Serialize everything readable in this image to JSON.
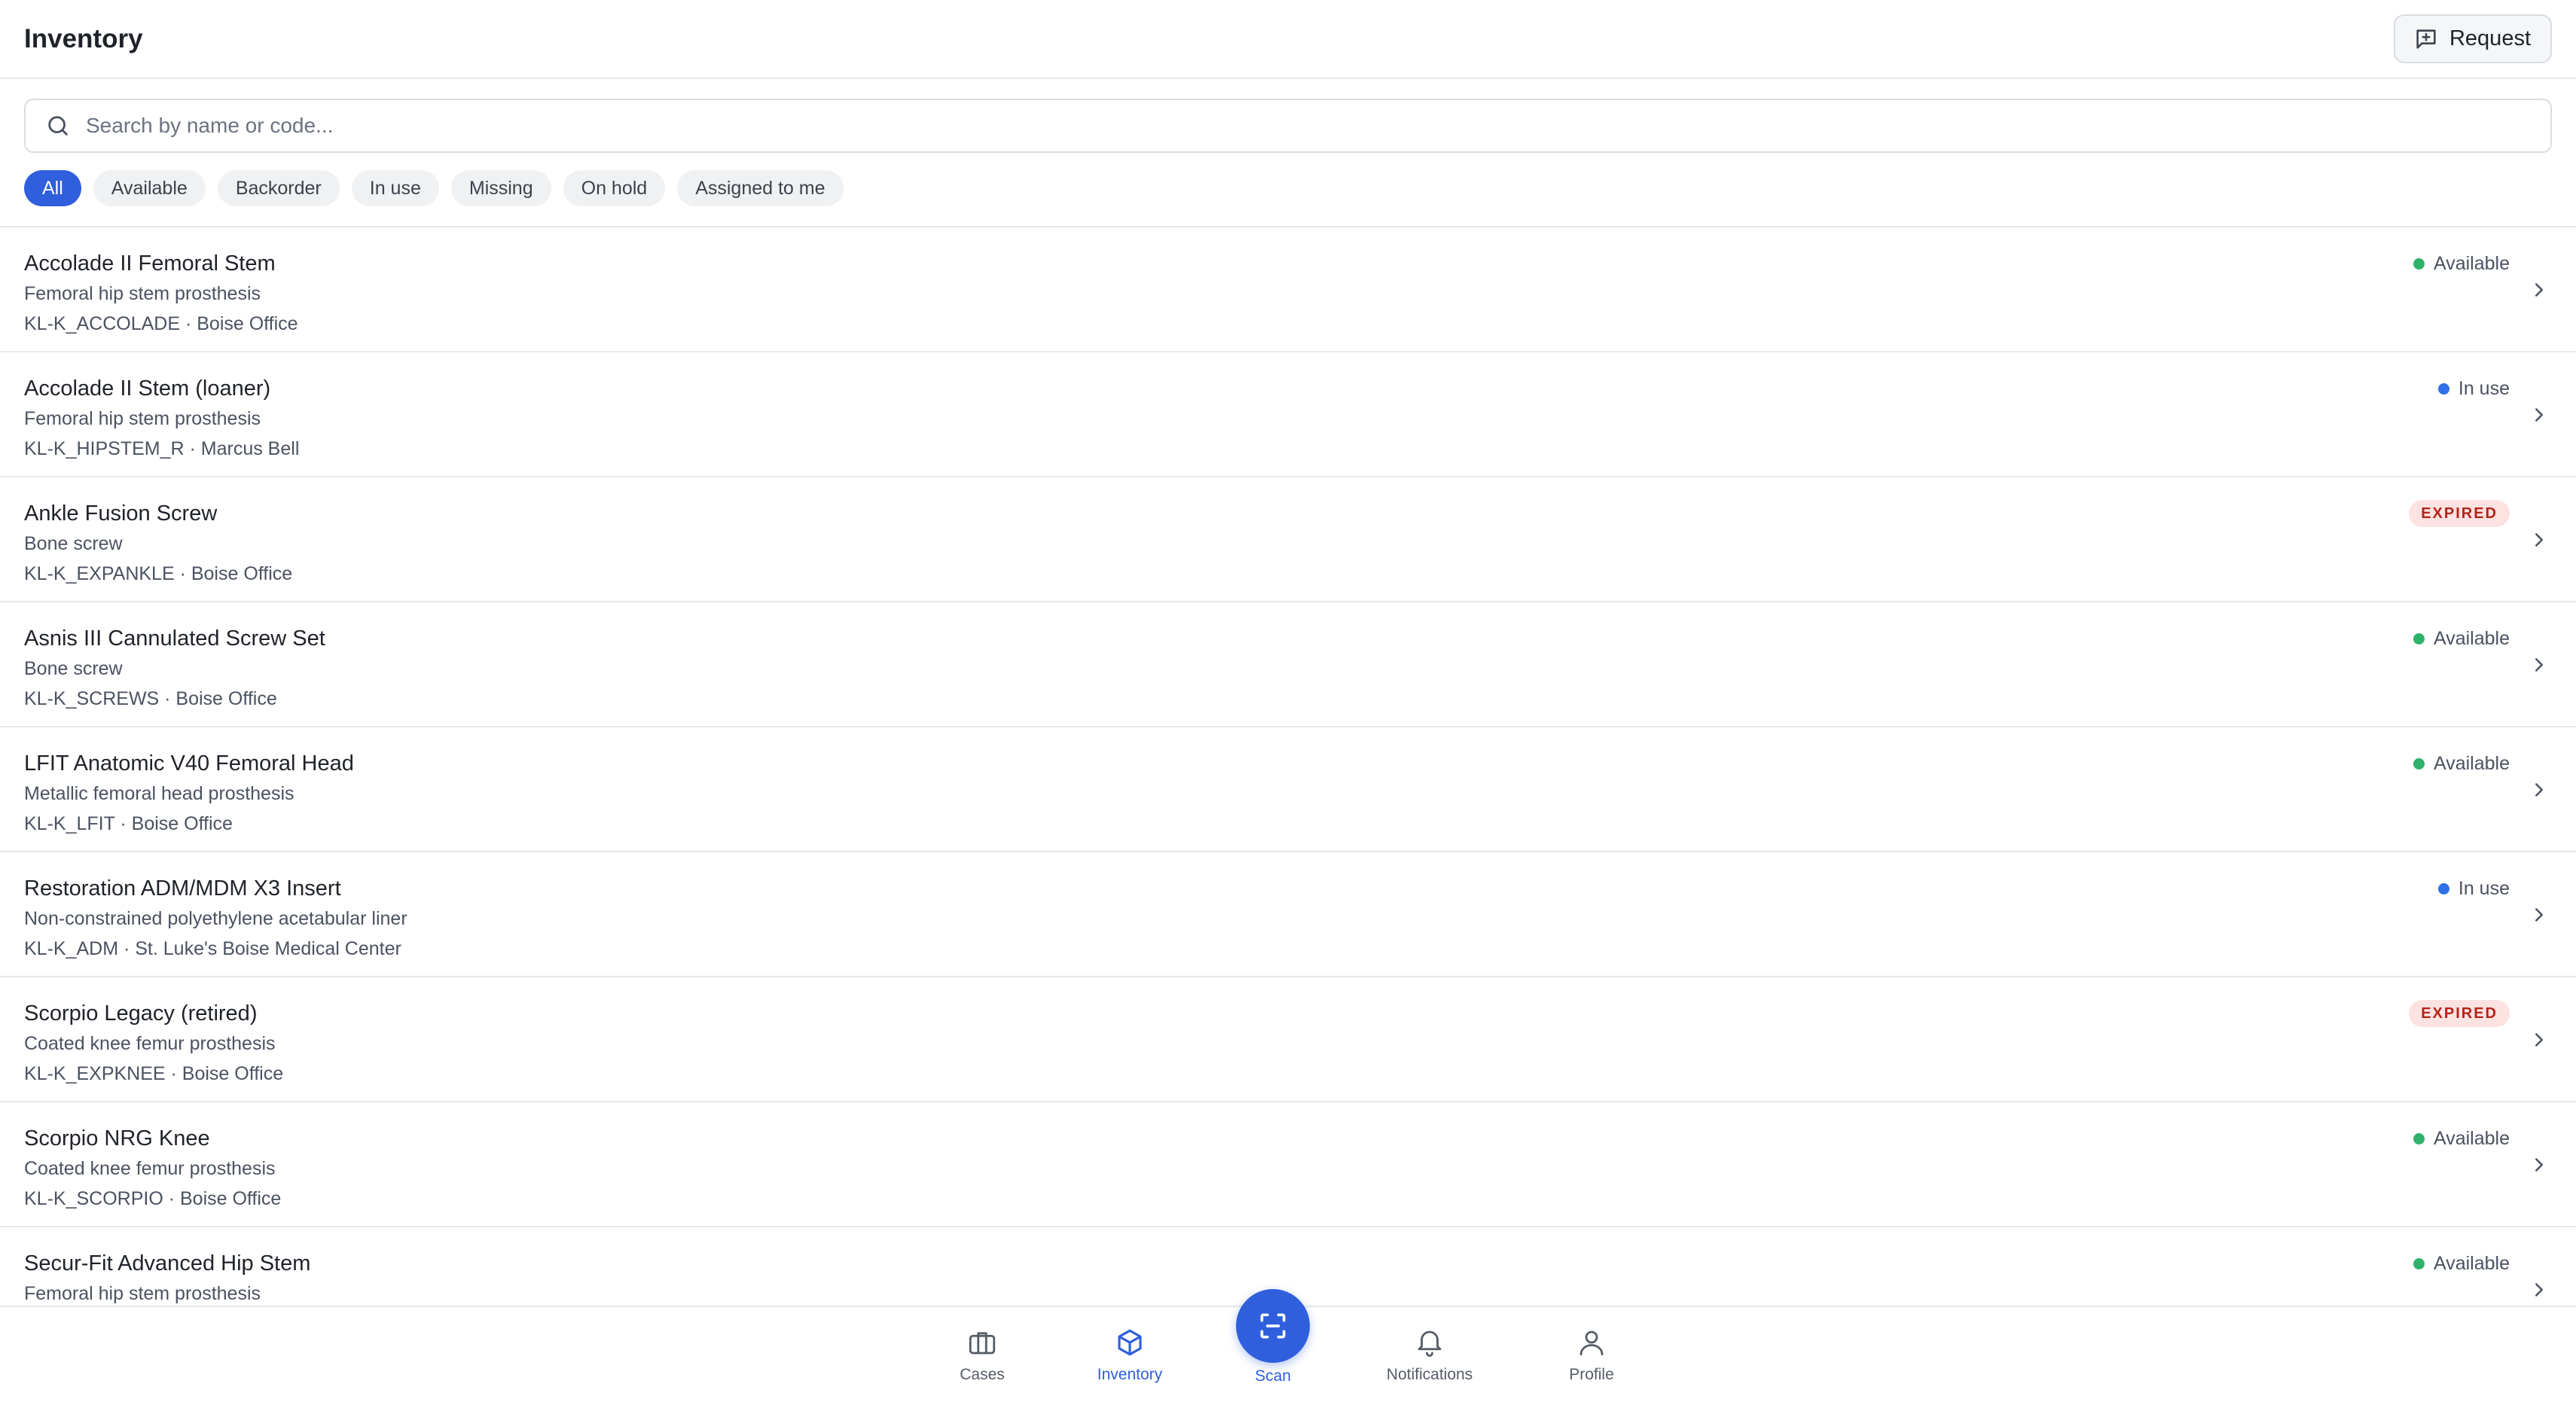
{
  "header": {
    "title": "Inventory",
    "request_label": "Request"
  },
  "search": {
    "placeholder": "Search by name or code..."
  },
  "filters": [
    "All",
    "Available",
    "Backorder",
    "In use",
    "Missing",
    "On hold",
    "Assigned to me"
  ],
  "items": [
    {
      "name": "Accolade II Femoral Stem",
      "description": "Femoral hip stem prosthesis",
      "meta": "KL-K_ACCOLADE · Boise Office",
      "status": "Available"
    },
    {
      "name": "Accolade II Stem (loaner)",
      "description": "Femoral hip stem prosthesis",
      "meta": "KL-K_HIPSTEM_R · Marcus Bell",
      "status": "In use"
    },
    {
      "name": "Ankle Fusion Screw",
      "description": "Bone screw",
      "meta": "KL-K_EXPANKLE · Boise Office",
      "status": "EXPIRED"
    },
    {
      "name": "Asnis III Cannulated Screw Set",
      "description": "Bone screw",
      "meta": "KL-K_SCREWS · Boise Office",
      "status": "Available"
    },
    {
      "name": "LFIT Anatomic V40 Femoral Head",
      "description": "Metallic femoral head prosthesis",
      "meta": "KL-K_LFIT · Boise Office",
      "status": "Available"
    },
    {
      "name": "Restoration ADM/MDM X3 Insert",
      "description": "Non-constrained polyethylene acetabular liner",
      "meta": "KL-K_ADM · St. Luke's Boise Medical Center",
      "status": "In use"
    },
    {
      "name": "Scorpio Legacy (retired)",
      "description": "Coated knee femur prosthesis",
      "meta": "KL-K_EXPKNEE · Boise Office",
      "status": "EXPIRED"
    },
    {
      "name": "Scorpio NRG Knee",
      "description": "Coated knee femur prosthesis",
      "meta": "KL-K_SCORPIO · Boise Office",
      "status": "Available"
    },
    {
      "name": "Secur-Fit Advanced Hip Stem",
      "description": "Femoral hip stem prosthesis",
      "meta": "",
      "status": "Available"
    }
  ],
  "status_colors": {
    "Available": "#2fb36b",
    "In use": "#2f6fe8",
    "EXPIRED": "#b42318"
  },
  "accent_color": "#2f5fdc",
  "nav": {
    "cases": "Cases",
    "inventory": "Inventory",
    "scan": "Scan",
    "notifications": "Notifications",
    "profile": "Profile"
  }
}
